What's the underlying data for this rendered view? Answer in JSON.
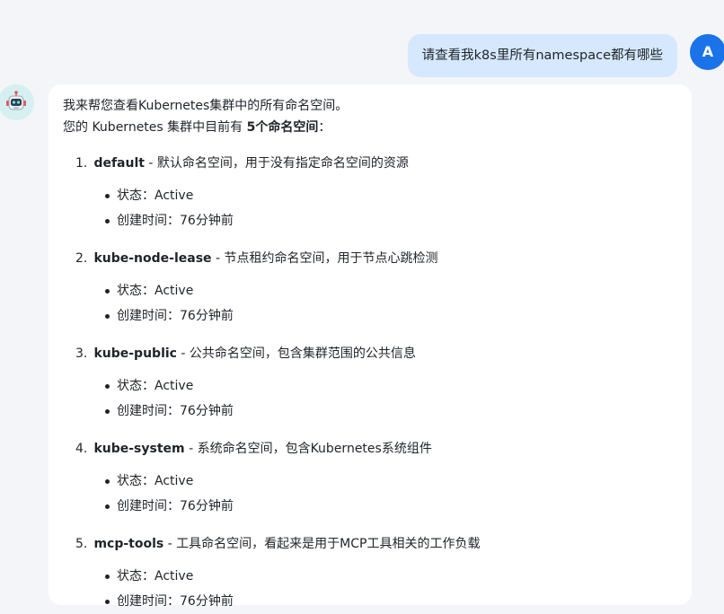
{
  "user_message": {
    "text": "请查看我k8s里所有namespace都有哪些",
    "avatar_letter": "A"
  },
  "assistant": {
    "intro_line": "我来帮您查看Kubernetes集群中的所有命名空间。",
    "summary_prefix": "您的 Kubernetes 集群中目前有 ",
    "summary_bold": "5个命名空间",
    "summary_suffix": "：",
    "namespaces": [
      {
        "num": "1.",
        "name": "default",
        "desc": " - 默认命名空间，用于没有指定命名空间的资源",
        "status": "状态：Active",
        "created": "创建时间：76分钟前"
      },
      {
        "num": "2.",
        "name": "kube-node-lease",
        "desc": " - 节点租约命名空间，用于节点心跳检测",
        "status": "状态：Active",
        "created": "创建时间：76分钟前"
      },
      {
        "num": "3.",
        "name": "kube-public",
        "desc": " - 公共命名空间，包含集群范围的公共信息",
        "status": "状态：Active",
        "created": "创建时间：76分钟前"
      },
      {
        "num": "4.",
        "name": "kube-system",
        "desc": " - 系统命名空间，包含Kubernetes系统组件",
        "status": "状态：Active",
        "created": "创建时间：76分钟前"
      },
      {
        "num": "5.",
        "name": "mcp-tools",
        "desc": " - 工具命名空间，看起来是用于MCP工具相关的工作负载",
        "status": "状态：Active",
        "created": "创建时间：76分钟前"
      }
    ]
  },
  "colors": {
    "page_bg": "#f3f5f8",
    "user_bubble": "#d6e8fd",
    "user_avatar": "#1a73e8",
    "bot_avatar_bg": "#d6f0f2",
    "card_bg": "#ffffff"
  },
  "icons": {
    "bot_avatar": "robot-icon"
  }
}
